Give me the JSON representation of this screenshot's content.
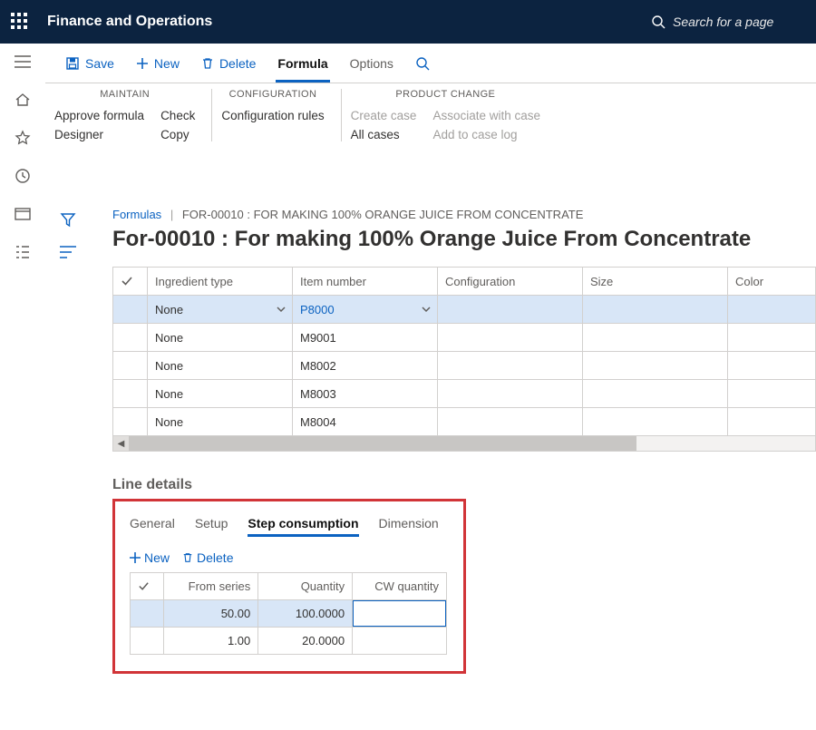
{
  "app": {
    "title": "Finance and Operations",
    "search_placeholder": "Search for a page"
  },
  "actions": {
    "save": "Save",
    "new": "New",
    "delete": "Delete"
  },
  "tabs": {
    "formula": "Formula",
    "options": "Options"
  },
  "ribbon": {
    "maintain": {
      "label": "MAINTAIN",
      "approve_formula": "Approve formula",
      "designer": "Designer",
      "check": "Check",
      "copy": "Copy"
    },
    "configuration": {
      "label": "CONFIGURATION",
      "configuration_rules": "Configuration rules"
    },
    "product_change": {
      "label": "PRODUCT CHANGE",
      "create_case": "Create case",
      "all_cases": "All cases",
      "associate_with_case": "Associate with case",
      "add_to_case_log": "Add to case log"
    }
  },
  "breadcrumb": {
    "root": "Formulas",
    "record": "FOR-00010 : FOR MAKING 100% ORANGE JUICE FROM CONCENTRATE"
  },
  "page_title": "For-00010 : For making 100% Orange Juice From Concentrate",
  "grid": {
    "headers": {
      "ingredient_type": "Ingredient type",
      "item_number": "Item number",
      "configuration": "Configuration",
      "size": "Size",
      "color": "Color"
    },
    "rows": [
      {
        "ingredient_type": "None",
        "item_number": "P8000",
        "selected": true
      },
      {
        "ingredient_type": "None",
        "item_number": "M9001",
        "selected": false
      },
      {
        "ingredient_type": "None",
        "item_number": "M8002",
        "selected": false
      },
      {
        "ingredient_type": "None",
        "item_number": "M8003",
        "selected": false
      },
      {
        "ingredient_type": "None",
        "item_number": "M8004",
        "selected": false
      }
    ]
  },
  "line_details": {
    "title": "Line details",
    "tabs": {
      "general": "General",
      "setup": "Setup",
      "step_consumption": "Step consumption",
      "dimension": "Dimension"
    },
    "actions": {
      "new": "New",
      "delete": "Delete"
    },
    "step_grid": {
      "headers": {
        "from_series": "From series",
        "quantity": "Quantity",
        "cw_quantity": "CW quantity"
      },
      "rows": [
        {
          "from_series": "50.00",
          "quantity": "100.0000",
          "cw_quantity": "",
          "selected": true
        },
        {
          "from_series": "1.00",
          "quantity": "20.0000",
          "cw_quantity": "",
          "selected": false
        }
      ]
    }
  }
}
